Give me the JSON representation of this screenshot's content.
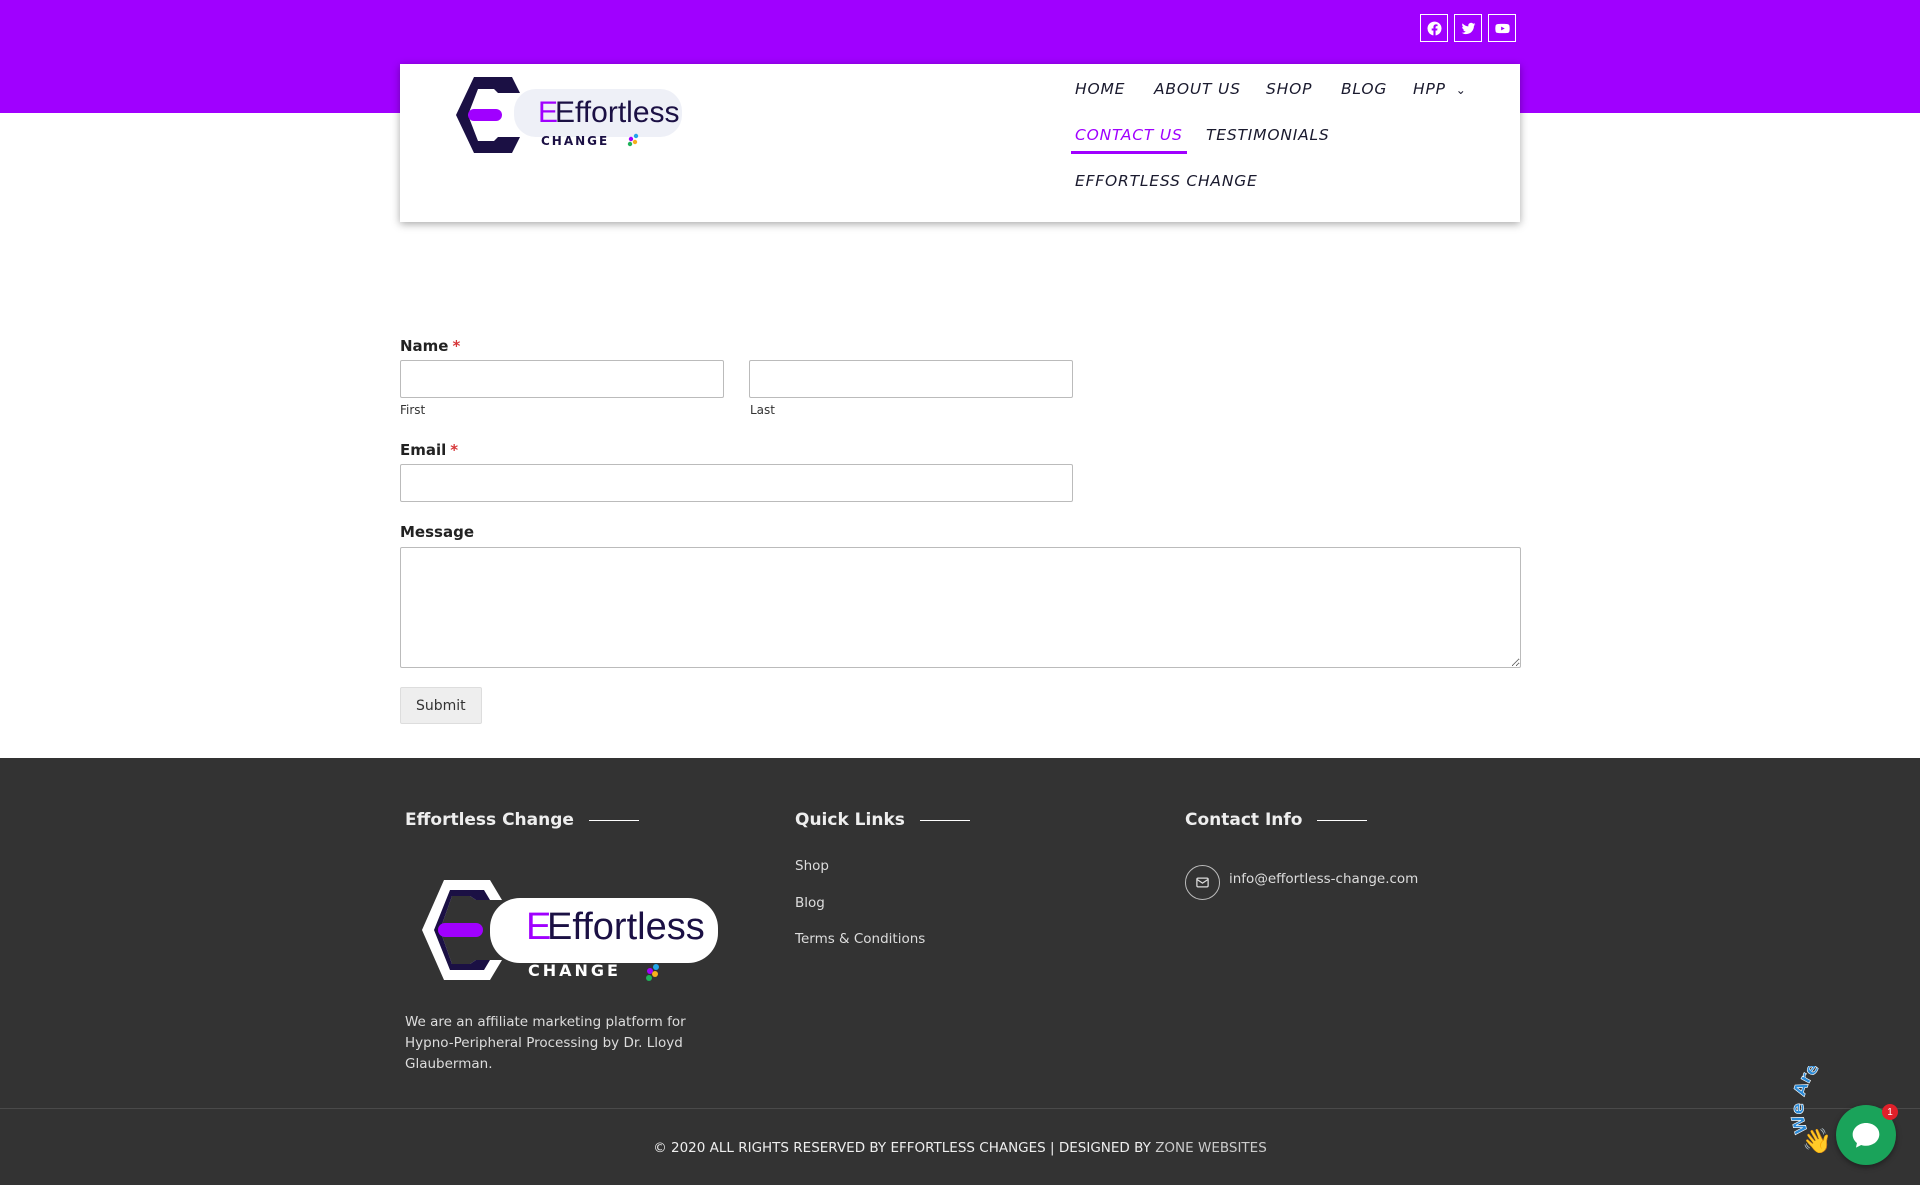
{
  "topbar": {
    "color": "#a000ff",
    "social_icons": [
      "facebook-icon",
      "twitter-icon",
      "youtube-icon"
    ]
  },
  "header": {
    "logo": {
      "word": "Effortless",
      "word_highlight": "E",
      "subword": "CHANGE"
    },
    "nav": {
      "home": "HOME",
      "about": "ABOUT US",
      "shop": "SHOP",
      "blog": "BLOG",
      "hpp": "HPP",
      "contact": "CONTACT US",
      "testimonials": "TESTIMONIALS",
      "effortless": "EFFORTLESS CHANGE",
      "active": "contact"
    }
  },
  "form": {
    "name_label": "Name",
    "required_mark": "*",
    "first_label": "First",
    "last_label": "Last",
    "first_value": "",
    "last_value": "",
    "email_label": "Email",
    "email_value": "",
    "message_label": "Message",
    "message_value": "",
    "submit_label": "Submit"
  },
  "footer": {
    "col1_title": "Effortless Change",
    "col2_title": "Quick Links",
    "col3_title": "Contact Info",
    "logo": {
      "word": "Effortless",
      "word_highlight": "E",
      "subword": "CHANGE"
    },
    "about_text": "We are an affiliate marketing platform for Hypno-Peripheral Processing by Dr. Lloyd Glauberman.",
    "links": [
      "Shop",
      "Blog",
      "Terms & Conditions"
    ],
    "email": "info@effortless-change.com",
    "copyright_prefix": "© 2020 ALL RIGHTS RESERVED BY EFFORTLESS CHANGES | DESIGNED BY ",
    "designer": "ZONE WEBSITES"
  },
  "chat": {
    "caption": "We Are Here!",
    "badge": "1",
    "wave": "👋"
  },
  "colors": {
    "accent": "#a000ff",
    "logo_dark": "#1b1044",
    "footer_bg": "#333333",
    "chat_green": "#1aa35a"
  }
}
